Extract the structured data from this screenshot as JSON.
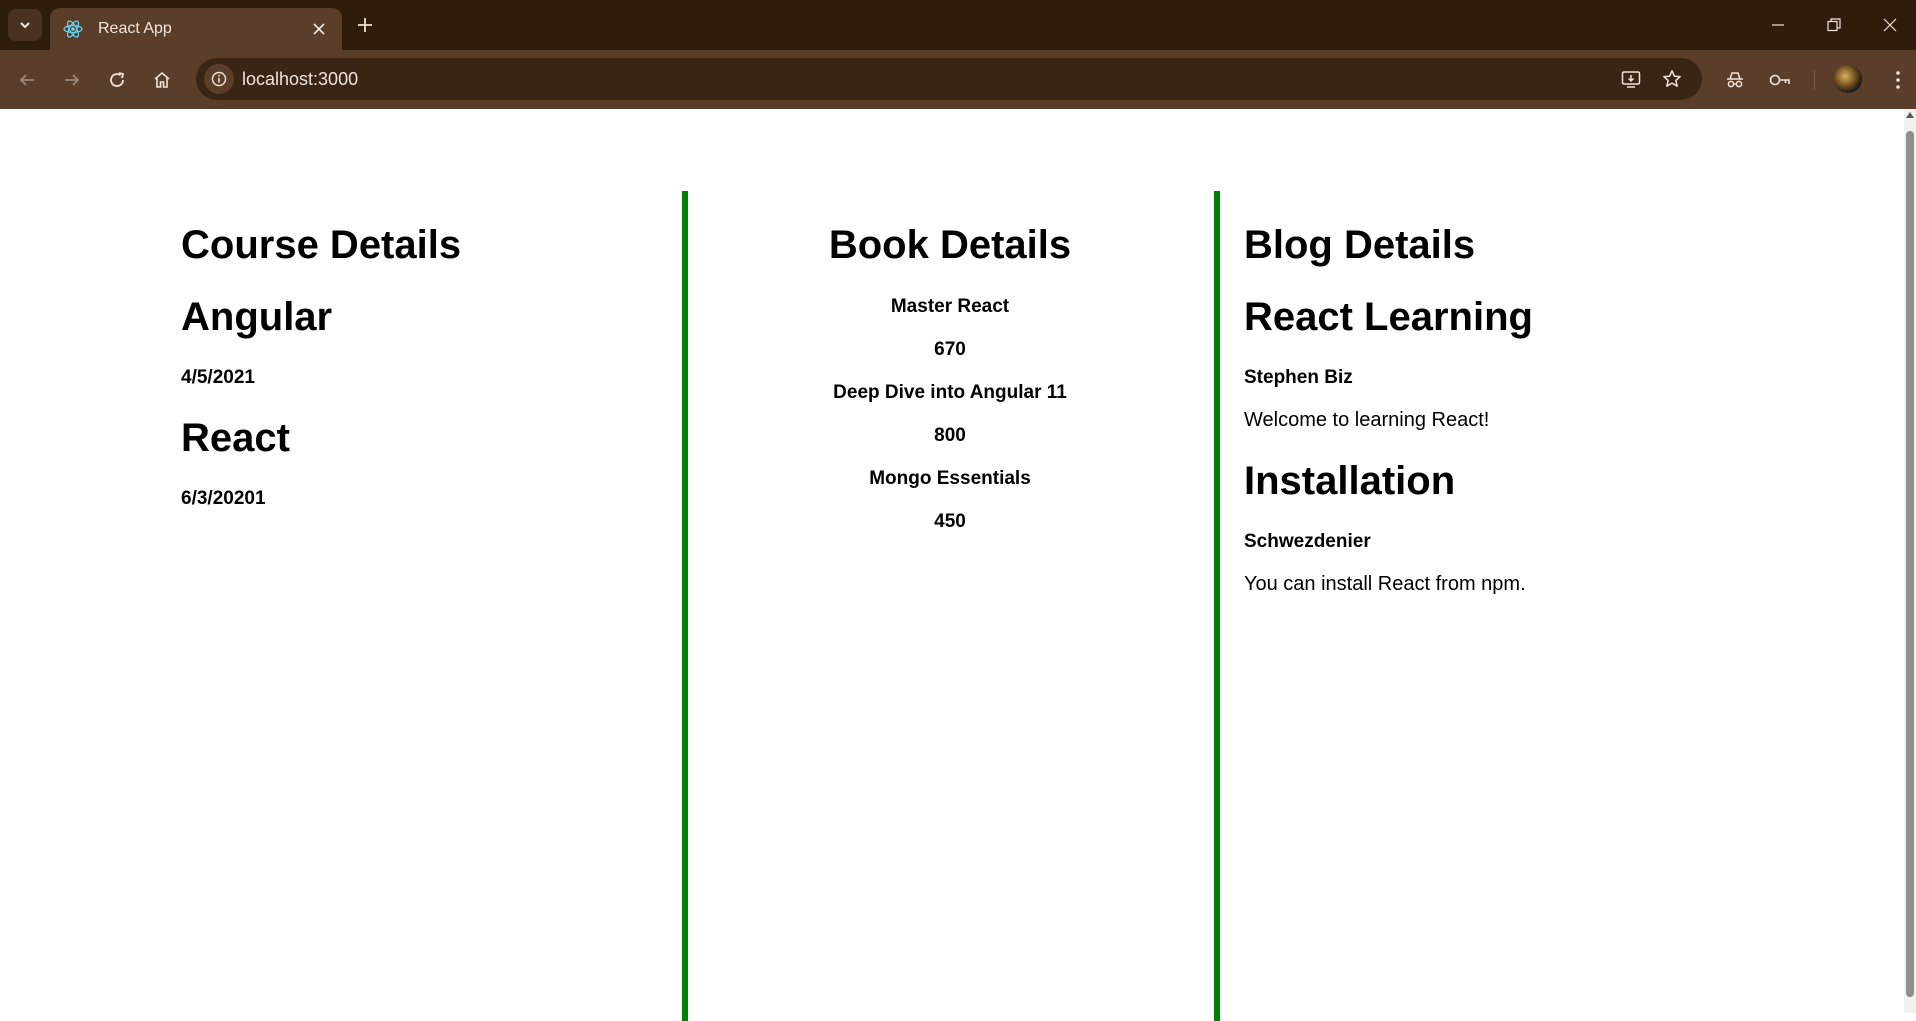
{
  "browser": {
    "tab_title": "React App",
    "url": "localhost:3000"
  },
  "course": {
    "heading": "Course Details",
    "items": [
      {
        "name": "Angular",
        "date": "4/5/2021"
      },
      {
        "name": "React",
        "date": "6/3/20201"
      }
    ]
  },
  "book": {
    "heading": "Book Details",
    "items": [
      {
        "name": "Master React",
        "price": "670"
      },
      {
        "name": "Deep Dive into Angular 11",
        "price": "800"
      },
      {
        "name": "Mongo Essentials",
        "price": "450"
      }
    ]
  },
  "blog": {
    "heading": "Blog Details",
    "items": [
      {
        "title": "React Learning",
        "author": "Stephen Biz",
        "content": "Welcome to learning React!"
      },
      {
        "title": "Installation",
        "author": "Schwezdenier",
        "content": "You can install React from npm."
      }
    ]
  },
  "colors": {
    "divider": "#008000",
    "chrome_dark": "#2f1d0c",
    "chrome_toolbar": "#5b3e2a"
  }
}
